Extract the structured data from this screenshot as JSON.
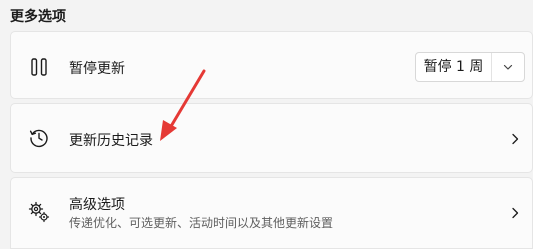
{
  "section": {
    "title": "更多选项"
  },
  "pause_updates": {
    "label": "暂停更新",
    "icon": "pause-icon",
    "dropdown_value": "暂停 1 周",
    "dropdown_icon": "chevron-down-icon"
  },
  "update_history": {
    "label": "更新历史记录",
    "icon": "history-icon",
    "chevron": "chevron-right-icon"
  },
  "advanced_options": {
    "label": "高级选项",
    "description": "传递优化、可选更新、活动时间以及其他更新设置",
    "icon": "gears-icon",
    "chevron": "chevron-right-icon"
  },
  "colors": {
    "background": "#f3f3f3",
    "card": "#fbfbfb",
    "annotation_arrow": "#e53935"
  }
}
